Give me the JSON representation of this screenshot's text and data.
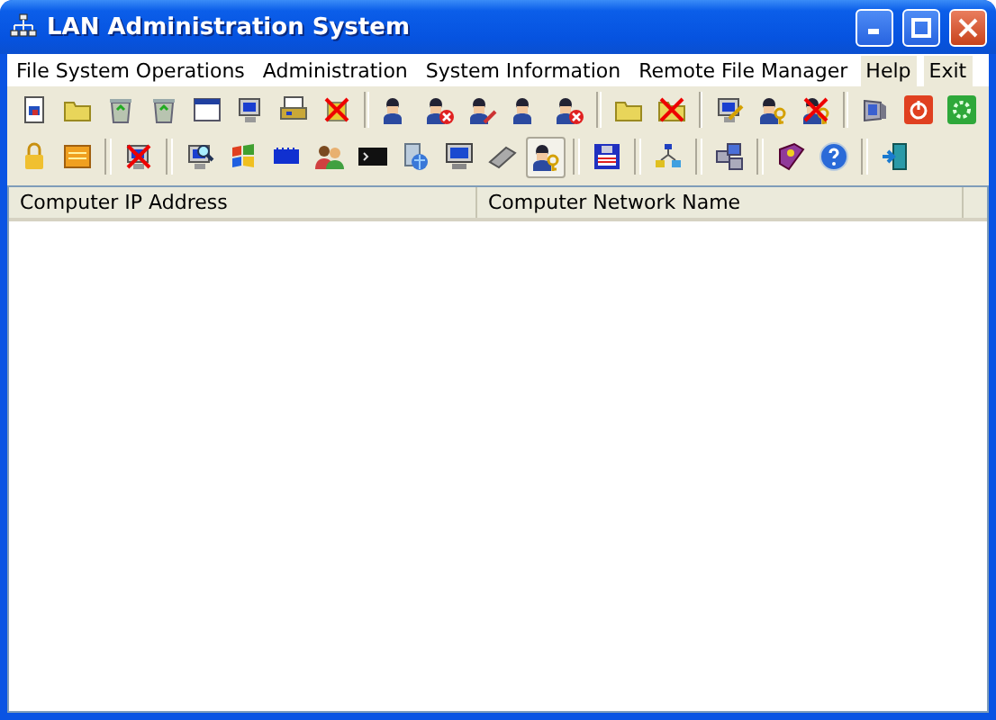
{
  "window": {
    "title": "LAN Administration System"
  },
  "menu": [
    {
      "label": "File System Operations",
      "selected": false
    },
    {
      "label": "Administration",
      "selected": false
    },
    {
      "label": "System Information",
      "selected": false
    },
    {
      "label": "Remote File Manager",
      "selected": false
    },
    {
      "label": "Help",
      "selected": true
    },
    {
      "label": "Exit",
      "selected": true
    }
  ],
  "toolbars": [
    {
      "groups": [
        [
          {
            "pressed": false
          },
          {
            "pressed": false
          },
          {
            "pressed": false
          },
          {
            "pressed": false
          },
          {
            "pressed": false
          },
          {
            "pressed": false
          },
          {
            "pressed": false
          },
          {
            "pressed": false
          }
        ],
        [
          {
            "pressed": false
          },
          {
            "pressed": false
          },
          {
            "pressed": false
          },
          {
            "pressed": false
          },
          {
            "pressed": false
          }
        ],
        [
          {
            "pressed": false
          },
          {
            "pressed": false
          }
        ],
        [
          {
            "pressed": false
          },
          {
            "pressed": false
          },
          {
            "pressed": false
          }
        ],
        [
          {
            "pressed": false
          },
          {
            "pressed": false
          },
          {
            "pressed": false
          }
        ]
      ]
    },
    {
      "groups": [
        [
          {
            "pressed": false
          },
          {
            "pressed": false
          }
        ],
        [
          {
            "pressed": false
          }
        ],
        [
          {
            "pressed": false
          },
          {
            "pressed": false
          },
          {
            "pressed": false
          },
          {
            "pressed": false
          },
          {
            "pressed": false
          },
          {
            "pressed": false
          },
          {
            "pressed": false
          },
          {
            "pressed": false
          },
          {
            "pressed": true
          }
        ],
        [
          {
            "pressed": false
          }
        ],
        [
          {
            "pressed": false
          }
        ],
        [
          {
            "pressed": false
          }
        ],
        [
          {
            "pressed": false
          },
          {
            "pressed": false
          }
        ],
        [
          {
            "pressed": false
          }
        ]
      ]
    }
  ],
  "table": {
    "columns": [
      "Computer IP Address",
      "Computer Network Name"
    ]
  }
}
